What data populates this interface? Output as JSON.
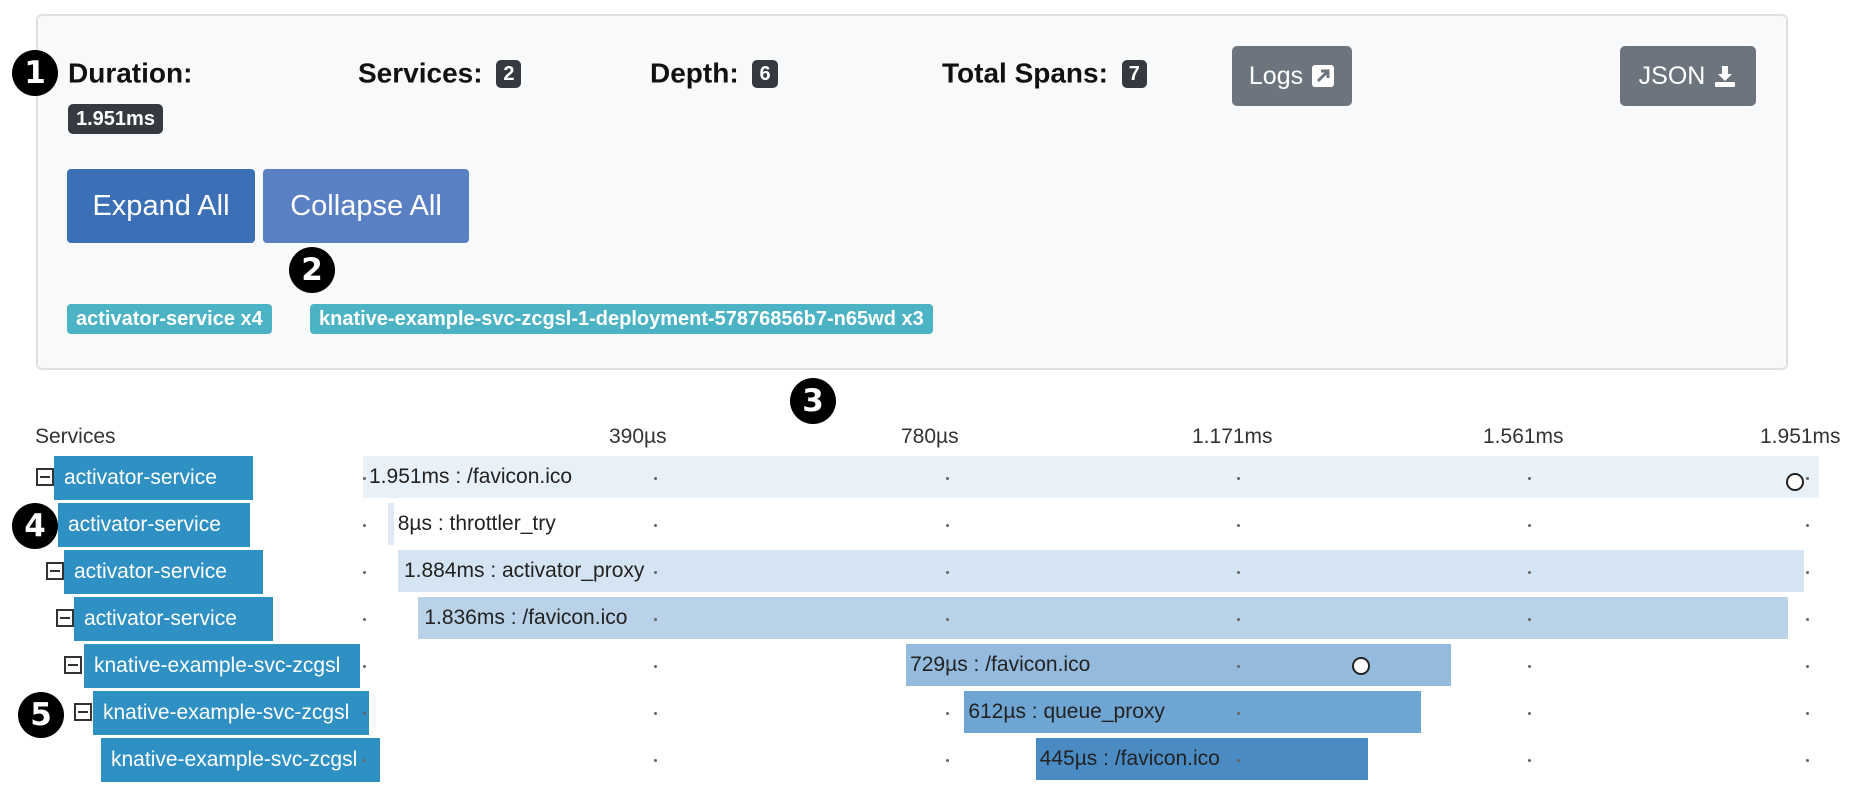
{
  "summary": {
    "duration_label": "Duration:",
    "duration_value": "1.951ms",
    "services_label": "Services:",
    "services_value": "2",
    "depth_label": "Depth:",
    "depth_value": "6",
    "total_spans_label": "Total Spans:",
    "total_spans_value": "7",
    "logs_label": "Logs",
    "json_label": "JSON",
    "expand_all_label": "Expand All",
    "collapse_all_label": "Collapse All",
    "service_chips": [
      "activator-service x4",
      "knative-example-svc-zcgsl-1-deployment-57876856b7-n65wd x3"
    ]
  },
  "callouts": [
    "1",
    "2",
    "3",
    "4",
    "5"
  ],
  "timeline": {
    "services_header": "Services",
    "ticks": [
      "390µs",
      "780µs",
      "1.171ms",
      "1.561ms",
      "1.951ms"
    ],
    "rows": [
      {
        "service": "activator-service",
        "span_label": "1.951ms : /favicon.ico",
        "start_fraction": 0.0,
        "duration_fraction": 1.0,
        "has_toggle": true,
        "color": "#e8f0f8"
      },
      {
        "service": "activator-service",
        "span_label": "8µs : throttler_try",
        "start_fraction": 0.017,
        "duration_fraction": 0.004,
        "has_toggle": false,
        "color": "#dfe9f4"
      },
      {
        "service": "activator-service",
        "span_label": "1.884ms : activator_proxy",
        "start_fraction": 0.024,
        "duration_fraction": 0.966,
        "has_toggle": true,
        "color": "#d4e4f2"
      },
      {
        "service": "activator-service",
        "span_label": "1.836ms : /favicon.ico",
        "start_fraction": 0.038,
        "duration_fraction": 0.941,
        "has_toggle": true,
        "color": "#b9d2e8"
      },
      {
        "service": "knative-example-svc-zcgsl",
        "span_label": "729µs : /favicon.ico",
        "start_fraction": 0.373,
        "duration_fraction": 0.374,
        "has_toggle": true,
        "color": "#94bbdd"
      },
      {
        "service": "knative-example-svc-zcgsl",
        "span_label": "612µs : queue_proxy",
        "start_fraction": 0.413,
        "duration_fraction": 0.314,
        "has_toggle": true,
        "color": "#6fa5d3"
      },
      {
        "service": "knative-example-svc-zcgsl",
        "span_label": "445µs : /favicon.ico",
        "start_fraction": 0.462,
        "duration_fraction": 0.228,
        "has_toggle": false,
        "color": "#4a8bc4"
      }
    ]
  },
  "colors": {
    "expand_button": "#3b6fb6",
    "collapse_button": "#5a80c4",
    "service_chip": "#4bb3c3",
    "service_label": "#2b8bbd",
    "dark_badge": "#343a40",
    "gray_button": "#6c757d"
  }
}
